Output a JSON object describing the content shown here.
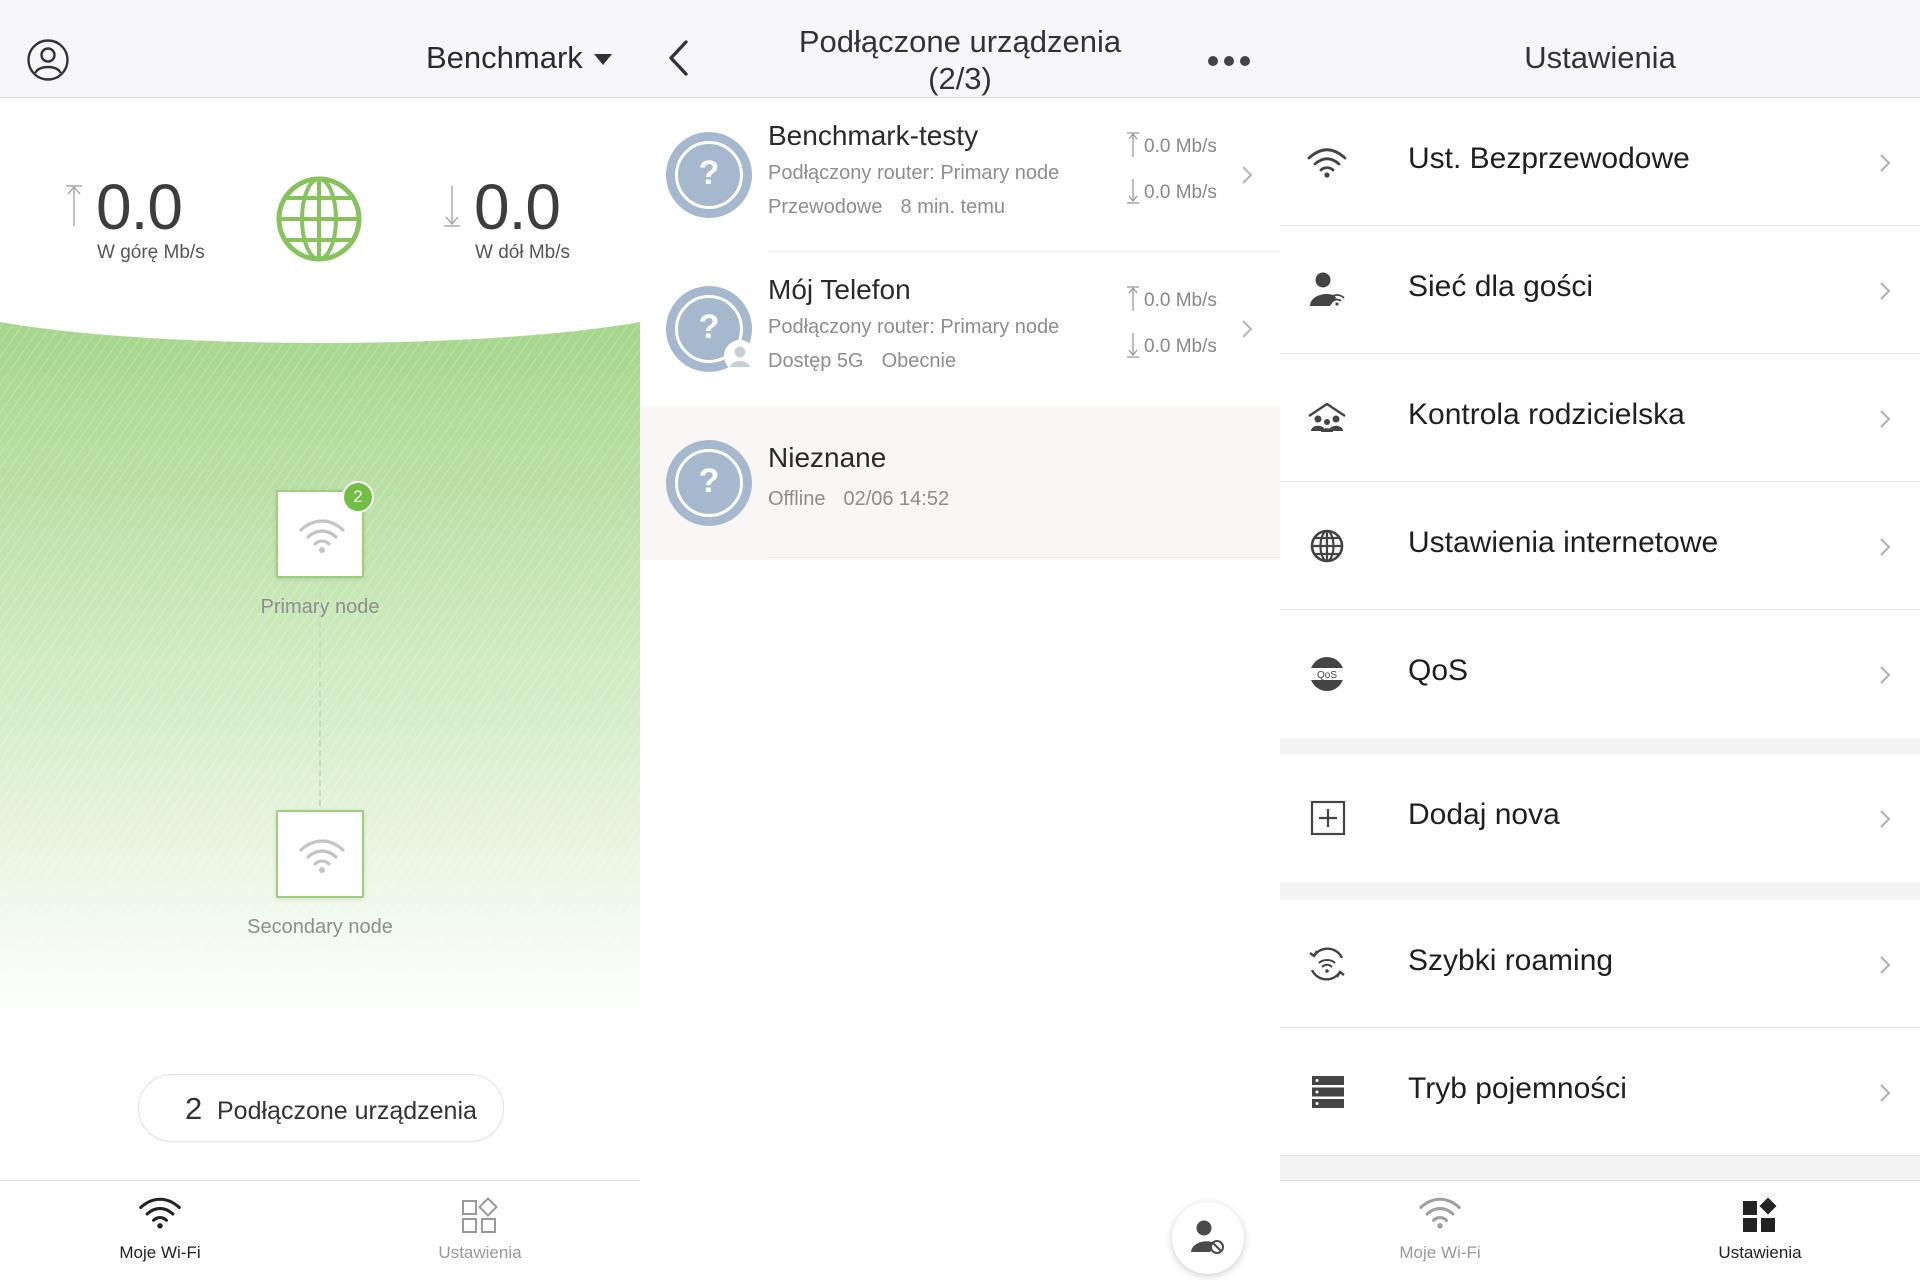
{
  "screen1": {
    "network_name": "Benchmark",
    "upload": {
      "value": "0.0",
      "label": "W górę Mb/s"
    },
    "download": {
      "value": "0.0",
      "label": "W dół Mb/s"
    },
    "primary_node": {
      "label": "Primary node",
      "badge": "2"
    },
    "secondary_node": {
      "label": "Secondary node"
    },
    "devices_pill": {
      "count": "2",
      "label": "Podłączone urządzenia"
    },
    "tabs": [
      {
        "label": "Moje Wi-Fi",
        "icon": "wifi-icon",
        "active": true
      },
      {
        "label": "Ustawienia",
        "icon": "grid-icon",
        "active": false
      }
    ],
    "colors": {
      "accent_green": "#72bf45",
      "node_border": "#9cd179"
    }
  },
  "screen2": {
    "title_line1": "Podłączone urządzenia",
    "title_line2": "(2/3)",
    "devices": [
      {
        "name": "Benchmark-testy",
        "router": "Podłączony router: Primary node",
        "connection": "Przewodowe",
        "time": "8 min. temu",
        "up": "0.0 Mb/s",
        "down": "0.0 Mb/s"
      },
      {
        "name": "Mój Telefon",
        "router": "Podłączony router: Primary node",
        "connection": "Dostęp 5G",
        "time": "Obecnie",
        "up": "0.0 Mb/s",
        "down": "0.0 Mb/s"
      },
      {
        "name": "Nieznane",
        "status": "Offline",
        "time": "02/06 14:52"
      }
    ],
    "device_icon_glyph": "?"
  },
  "screen3": {
    "title": "Ustawienia",
    "items": [
      {
        "label": "Ust. Bezprzewodowe",
        "icon": "wifi-icon"
      },
      {
        "label": "Sieć dla gości",
        "icon": "guest-user-icon"
      },
      {
        "label": "Kontrola rodzicielska",
        "icon": "family-icon"
      },
      {
        "label": "Ustawienia internetowe",
        "icon": "globe-icon"
      },
      {
        "label": "QoS",
        "icon": "qos-icon",
        "icon_text": "QoS"
      },
      {
        "label": "Dodaj nova",
        "icon": "add-icon"
      },
      {
        "label": "Szybki roaming",
        "icon": "roaming-icon"
      },
      {
        "label": "Tryb pojemności",
        "icon": "server-icon"
      }
    ],
    "tabs": [
      {
        "label": "Moje Wi-Fi",
        "icon": "wifi-icon",
        "active": false
      },
      {
        "label": "Ustawienia",
        "icon": "grid-icon",
        "active": true
      }
    ]
  }
}
